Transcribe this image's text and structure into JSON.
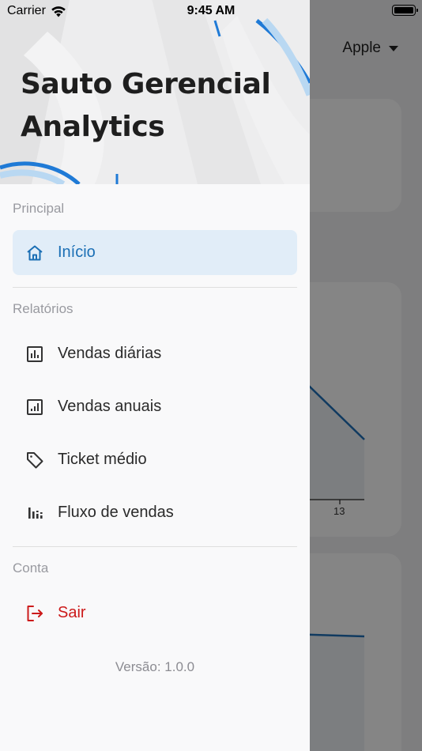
{
  "status_bar": {
    "carrier": "Carrier",
    "time": "9:45 AM"
  },
  "background": {
    "dropdown_value": "Apple",
    "chart_tick": "13"
  },
  "drawer": {
    "title": "Sauto Gerencial Analytics",
    "sections": {
      "principal": "Principal",
      "relatorios": "Relatórios",
      "conta": "Conta"
    },
    "items": {
      "inicio": {
        "label": "Início",
        "icon": "home-icon"
      },
      "vendas_diarias": {
        "label": "Vendas diárias",
        "icon": "bar-chart-icon"
      },
      "vendas_anuais": {
        "label": "Vendas anuais",
        "icon": "bar-chart-ascending-icon"
      },
      "ticket_medio": {
        "label": "Ticket médio",
        "icon": "tag-icon"
      },
      "fluxo_vendas": {
        "label": "Fluxo de vendas",
        "icon": "flow-bars-icon"
      },
      "sair": {
        "label": "Sair",
        "icon": "logout-icon"
      }
    },
    "version": "Versão: 1.0.0"
  },
  "colors": {
    "accent": "#1b6fb5",
    "active_bg": "#e1edf8",
    "danger": "#cc1a1a",
    "drawer_bg": "#f9f9fa"
  }
}
